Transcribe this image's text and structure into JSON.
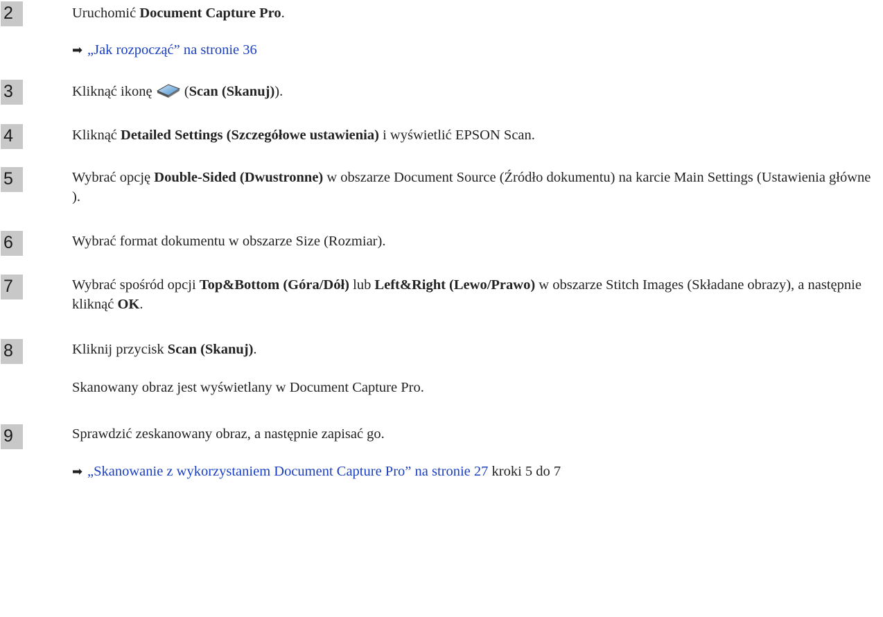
{
  "steps": [
    {
      "num": "2",
      "before": "Uruchomić ",
      "b1": "Document Capture Pro",
      "after": "."
    },
    {
      "num": "3",
      "before": "Kliknąć ikonę ",
      "mid": " (",
      "b1": "Scan (Skanuj)",
      "after": ")."
    },
    {
      "num": "4",
      "before": "Kliknąć ",
      "b1": "Detailed Settings (Szczegółowe ustawienia)",
      "after": " i wyświetlić EPSON Scan."
    },
    {
      "num": "5",
      "before": "Wybrać opcję ",
      "b1": "Double-Sided (Dwustronne)",
      "after": " w obszarze Document Source (Źródło dokumentu) na karcie Main Settings (Ustawienia główne )."
    },
    {
      "num": "6",
      "text": "Wybrać format dokumentu w obszarze Size (Rozmiar)."
    },
    {
      "num": "7",
      "before": "Wybrać spośród opcji ",
      "b1": "Top&Bottom (Góra/Dół)",
      "m1": " lub ",
      "b2": "Left&Right (Lewo/Prawo)",
      "m2": " w obszarze Stitch Images (Składane obrazy), a następnie kliknąć ",
      "b3": "OK",
      "after": "."
    },
    {
      "num": "8",
      "before": "Kliknij przycisk ",
      "b1": "Scan (Skanuj)",
      "after": ".",
      "sub": "Skanowany obraz jest wyświetlany w Document Capture Pro."
    },
    {
      "num": "9",
      "text": "Sprawdzić zeskanowany obraz, a następnie zapisać go."
    }
  ],
  "refs": {
    "r1": {
      "arrow": "➡",
      "link": "„Jak rozpocząć” na stronie 36",
      "tail": ""
    },
    "r2": {
      "arrow": "➡",
      "link": "„Skanowanie z wykorzystaniem Document Capture Pro” na stronie 27",
      "tail": " kroki 5 do 7"
    }
  },
  "icons": {
    "scan_icon": "scanner-icon"
  },
  "colors": {
    "link": "#1a3fbf",
    "badge": "#c8c8c8"
  }
}
